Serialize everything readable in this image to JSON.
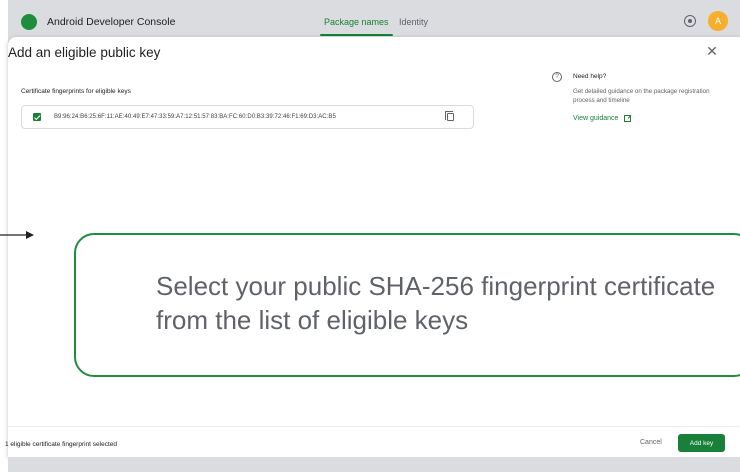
{
  "app": {
    "title": "Android Developer Console",
    "tabs": [
      {
        "label": "Package names",
        "active": true
      },
      {
        "label": "Identity",
        "active": false
      }
    ],
    "avatar_initial": "A",
    "icons": [
      "settings-icon"
    ]
  },
  "dialog": {
    "title": "Add an eligible public key",
    "section_label": "Certificate fingerprints for eligible keys",
    "fingerprints": [
      {
        "value": "B9:96:24:B6:25:6F:11:AE:40:49:E7:47:33:59:A7:12:51:57:83:BA:FC:60:D0:B3:39:72:46:F1:69:D3:AC:B5",
        "checked": true
      }
    ],
    "help": {
      "icon": "?",
      "title": "Need help?",
      "description": "Get detailed guidance on the package registration process and timeline",
      "link_label": "View guidance"
    },
    "footer": {
      "status": "1 eligible certificate fingerprint selected",
      "cancel_label": "Cancel",
      "add_label": "Add key"
    }
  },
  "callout": {
    "text": "Select your public SHA-256 fingerprint certificate from the list of eligible keys"
  },
  "colors": {
    "accent": "#188038",
    "callout_border": "#1e8e3e",
    "topbar": "#dadce0"
  }
}
